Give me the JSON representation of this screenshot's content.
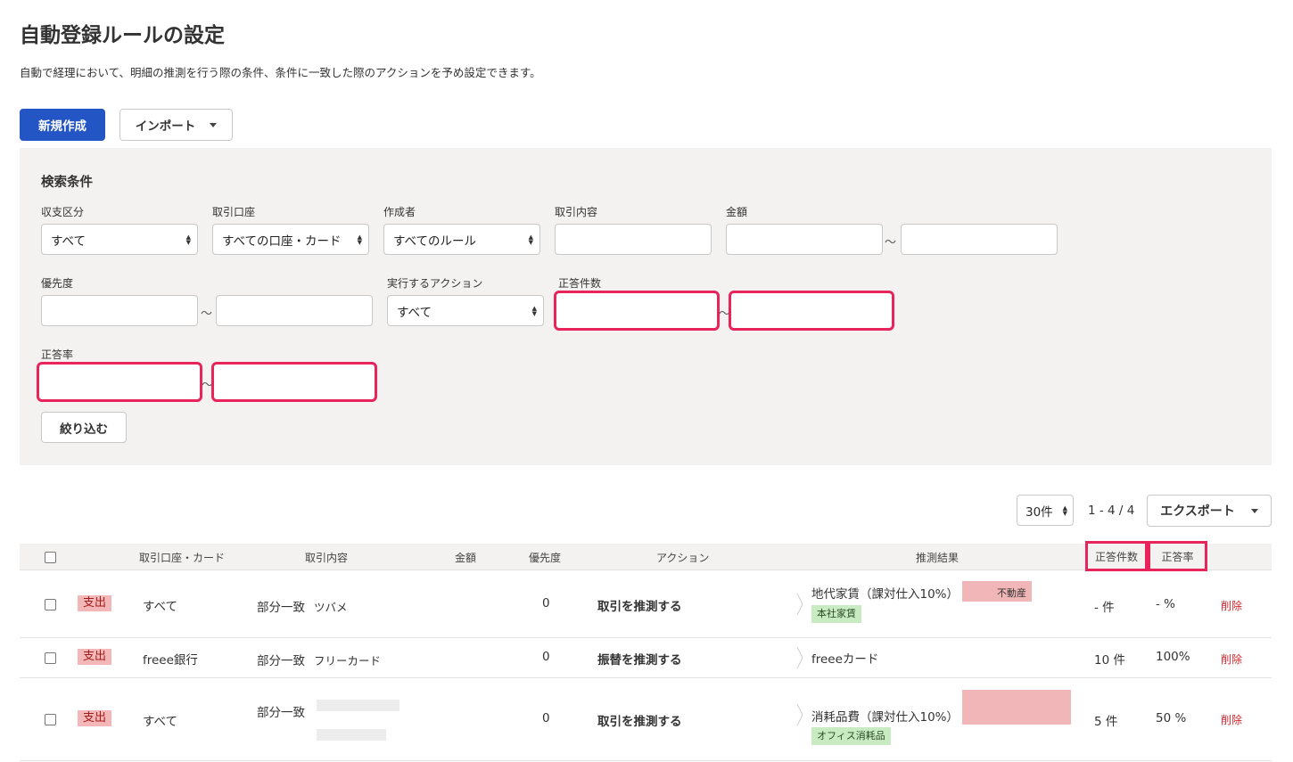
{
  "header": {
    "title": "自動登録ルールの設定",
    "description": "自動で経理において、明細の推測を行う際の条件、条件に一致した際のアクションを予め設定できます。"
  },
  "toolbar": {
    "new_label": "新規作成",
    "import_label": "インポート"
  },
  "search": {
    "title": "検索条件",
    "fields": {
      "type_label": "収支区分",
      "type_value": "すべて",
      "account_label": "取引口座",
      "account_value": "すべての口座・カード",
      "creator_label": "作成者",
      "creator_value": "すべてのルール",
      "content_label": "取引内容",
      "amount_label": "金額",
      "priority_label": "優先度",
      "action_label": "実行するアクション",
      "action_value": "すべて",
      "correct_count_label": "正答件数",
      "correct_rate_label": "正答率"
    },
    "tilde": "～",
    "filter_label": "絞り込む"
  },
  "pagination": {
    "per_page": "30件",
    "range": "1 - 4 / 4",
    "export_label": "エクスポート"
  },
  "table": {
    "headers": {
      "account": "取引口座・カード",
      "content": "取引内容",
      "amount": "金額",
      "priority": "優先度",
      "action": "アクション",
      "result": "推測結果",
      "correct_count": "正答件数",
      "correct_rate": "正答率"
    },
    "rows": [
      {
        "type": "支出",
        "account": "すべて",
        "match": "部分一致",
        "keyword": "ツバメ",
        "priority": "0",
        "action": "取引を推測する",
        "result": "地代家賃（課対仕入10%）",
        "partner_suffix": "不動産",
        "tag": "本社家賃",
        "count": "- 件",
        "rate": "- %",
        "delete": "削除"
      },
      {
        "type": "支出",
        "account": "freee銀行",
        "match": "部分一致",
        "keyword": "フリーカード",
        "priority": "0",
        "action": "振替を推測する",
        "result": "freeeカード",
        "count": "10 件",
        "rate": "100%",
        "delete": "削除"
      },
      {
        "type": "支出",
        "account": "すべて",
        "match": "部分一致",
        "priority": "0",
        "action": "取引を推測する",
        "result": "消耗品費（課対仕入10%）",
        "tag": "オフィス消耗品",
        "count": "5 件",
        "rate": "50 %",
        "delete": "削除"
      }
    ]
  },
  "colors": {
    "primary": "#2355c5",
    "highlight": "#e8245c",
    "expense_badge": "#f4b7b7",
    "tag_green": "#c9ebc2",
    "delete": "#d1262c"
  }
}
